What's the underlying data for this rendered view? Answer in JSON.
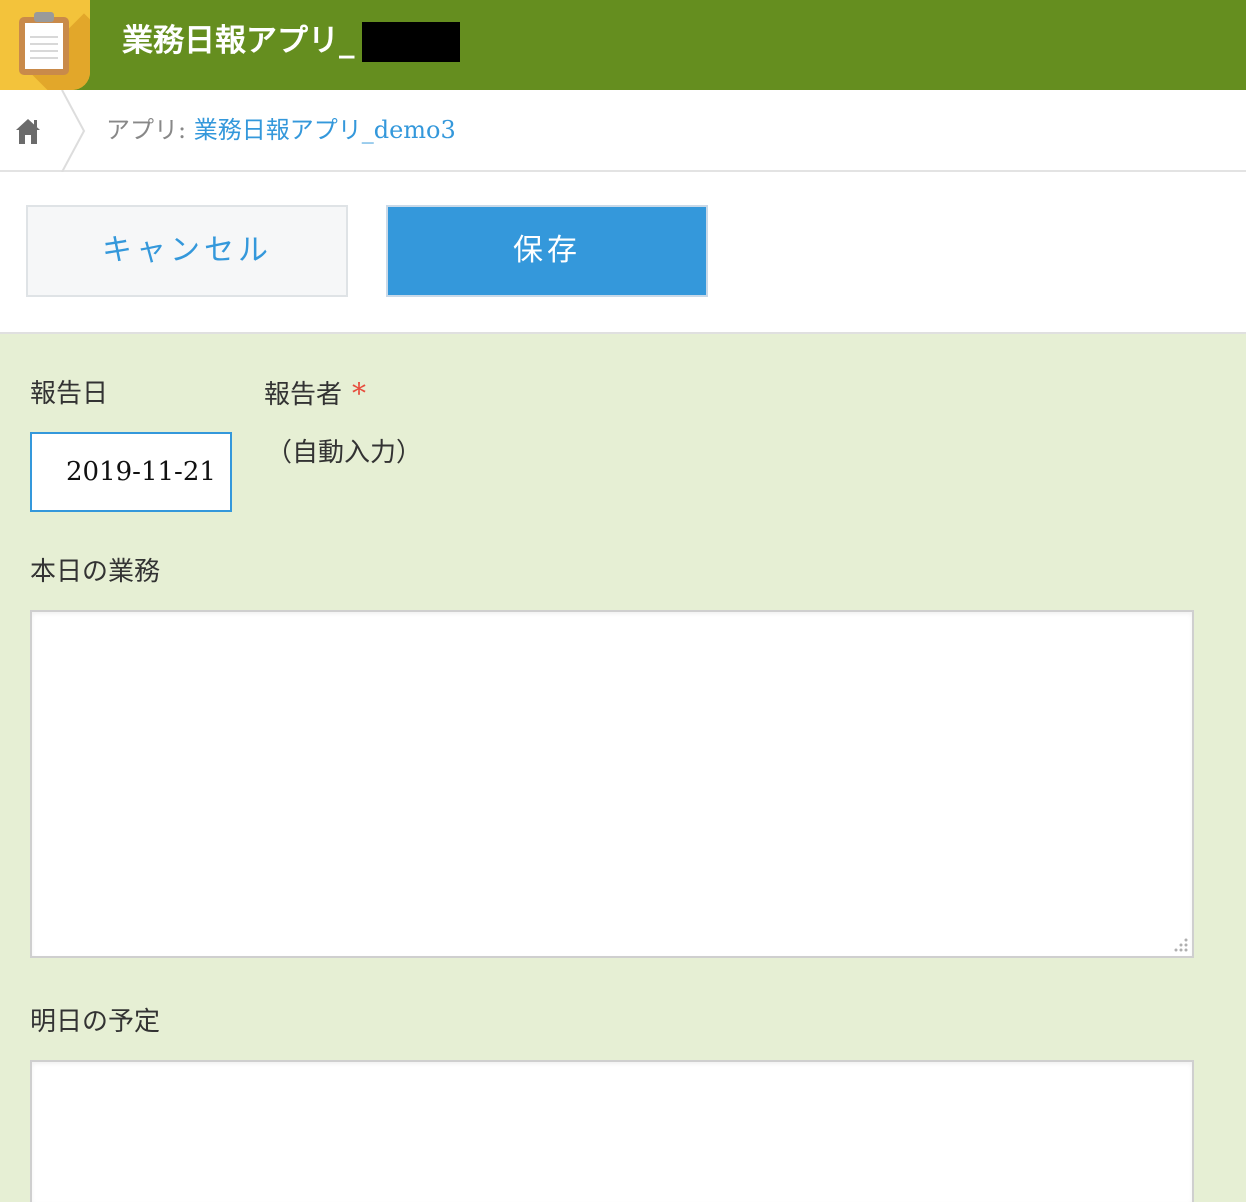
{
  "header": {
    "app_title": "業務日報アプリ_",
    "title_redacted": true,
    "background_color": "#658e1f",
    "icon": "clipboard-icon"
  },
  "breadcrumb": {
    "home_icon": "home-icon",
    "prefix": "アプリ: ",
    "app_link": "業務日報アプリ_demo3",
    "link_color": "#3498db"
  },
  "toolbar": {
    "cancel_label": "キャンセル",
    "save_label": "保存",
    "save_color": "#3498db"
  },
  "form": {
    "background_color": "#e6efd4",
    "report_date": {
      "label": "報告日",
      "value": "2019-11-21"
    },
    "reporter": {
      "label": "報告者",
      "required_mark": "*",
      "value": "（自動入力）"
    },
    "today_tasks": {
      "label": "本日の業務",
      "value": ""
    },
    "tomorrow_plan": {
      "label": "明日の予定",
      "value": ""
    }
  }
}
